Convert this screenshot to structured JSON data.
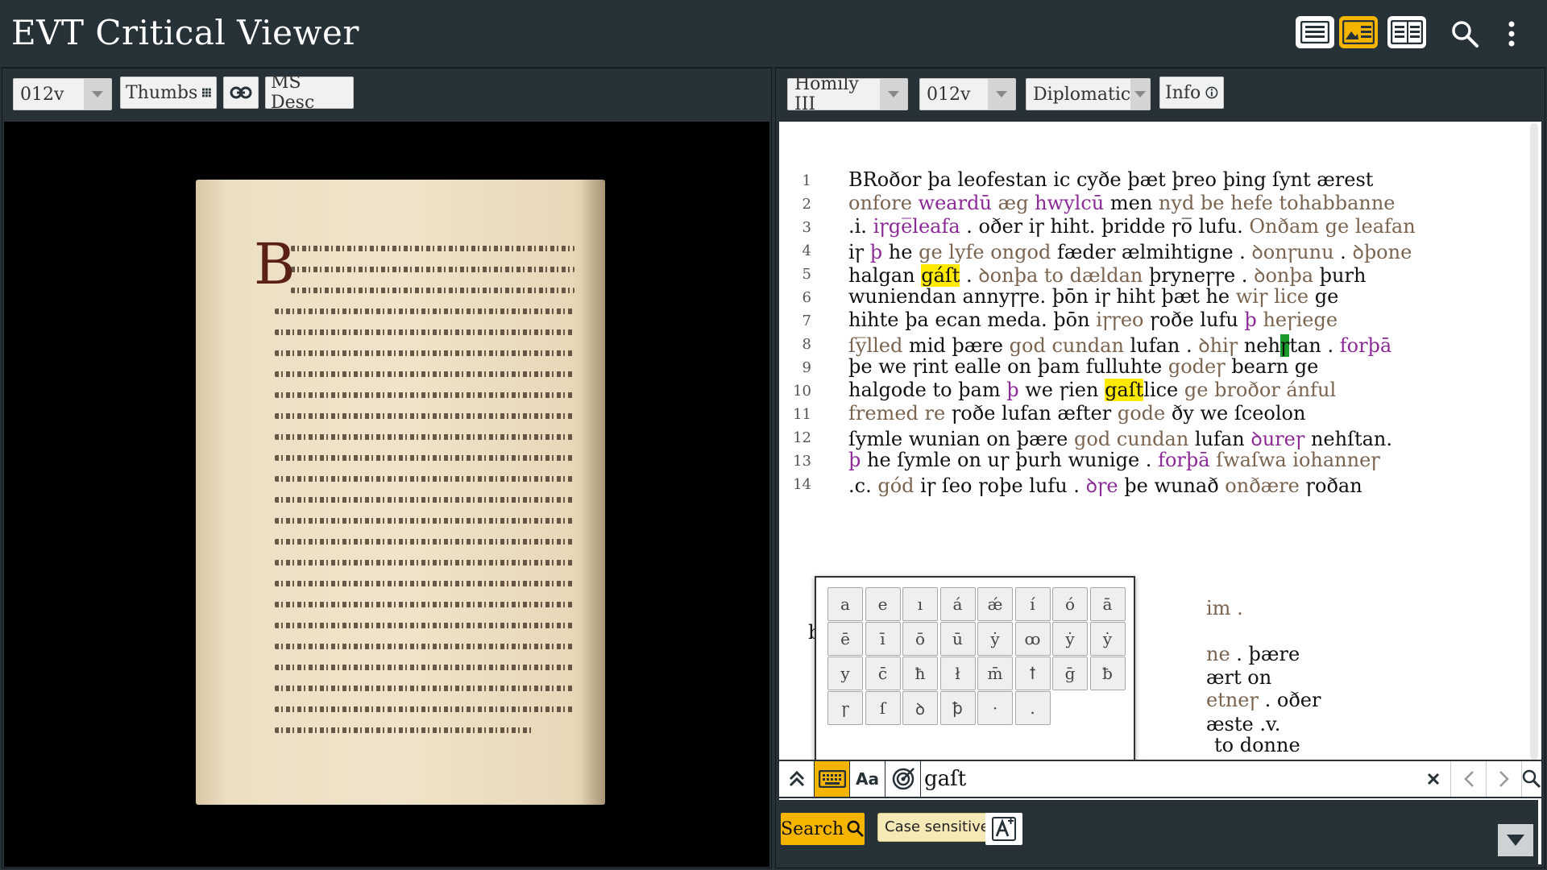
{
  "app": {
    "title": "EVT Critical Viewer"
  },
  "header": {
    "buttons": [
      "text-view-icon",
      "image-text-view-icon",
      "text-text-view-icon",
      "search-icon",
      "more-vert-icon"
    ]
  },
  "left_panel": {
    "page_select": "012v",
    "thumbs_label": "Thumbs",
    "ms_desc_label": "MS Desc"
  },
  "right_panel": {
    "document_select": "Homily III",
    "page_select": "012v",
    "edition_select": "Diplomatic",
    "info_label": "Info"
  },
  "text_lines": [
    {
      "n": "1",
      "segments": [
        {
          "t": "BRoðor þa leofestan ic cyðe þæt þreo þing ſynt ærest",
          "c": ""
        }
      ]
    },
    {
      "n": "2",
      "segments": [
        {
          "t": " onfore ",
          "c": "brown"
        },
        {
          "t": "weardū",
          "c": "purple"
        },
        {
          "t": " æg ",
          "c": "brown"
        },
        {
          "t": "hwylcū",
          "c": "purple"
        },
        {
          "t": " men ",
          "c": ""
        },
        {
          "t": "nyd be hefe tohabbanne",
          "c": "brown"
        }
      ]
    },
    {
      "n": "3",
      "segments": [
        {
          "t": ".i. ",
          "c": ""
        },
        {
          "t": "iꞅge̅leafa",
          "c": "purple"
        },
        {
          "t": " . oðer iꞅ hiht. þridde ꞅo̅ lufu. ",
          "c": ""
        },
        {
          "t": "Onðam ge leafan",
          "c": "brown"
        }
      ]
    },
    {
      "n": "4",
      "segments": [
        {
          "t": "iꞅ ",
          "c": ""
        },
        {
          "t": "þ",
          "c": "purple"
        },
        {
          "t": " he ",
          "c": ""
        },
        {
          "t": "ge lyfe ongod",
          "c": "brown"
        },
        {
          "t": " fæder ælmihtigne . ",
          "c": ""
        },
        {
          "t": "ꝺonꞅunu",
          "c": "brown"
        },
        {
          "t": " . ",
          "c": ""
        },
        {
          "t": "ꝺþone",
          "c": "brown"
        }
      ]
    },
    {
      "n": "5",
      "segments": [
        {
          "t": "halgan ",
          "c": ""
        },
        {
          "t": "gáſt",
          "c": "hl"
        },
        {
          "t": " . ",
          "c": ""
        },
        {
          "t": "ꝺonþa to dældan",
          "c": "brown"
        },
        {
          "t": " þryneꞅꞅe . ",
          "c": ""
        },
        {
          "t": "ꝺonþa",
          "c": "brown"
        },
        {
          "t": " þurh",
          "c": ""
        }
      ]
    },
    {
      "n": "6",
      "segments": [
        {
          "t": "wuniendan annyꞅꞅe. þōn iꞅ hiht þæt he ",
          "c": ""
        },
        {
          "t": "wiꞅ lice",
          "c": "brown"
        },
        {
          "t": " ge",
          "c": ""
        }
      ]
    },
    {
      "n": "7",
      "segments": [
        {
          "t": "hihte þa ecan meda. þōn ",
          "c": ""
        },
        {
          "t": "iꞅꞅeo",
          "c": "brown"
        },
        {
          "t": " ꞅoðe lufu ",
          "c": ""
        },
        {
          "t": "þ",
          "c": "purple"
        },
        {
          "t": " ",
          "c": ""
        },
        {
          "t": "heꞅiege",
          "c": "brown"
        }
      ]
    },
    {
      "n": "8",
      "segments": [
        {
          "t": "ſy̅lled",
          "c": "brown"
        },
        {
          "t": " mid þære ",
          "c": ""
        },
        {
          "t": "god cundan",
          "c": "brown"
        },
        {
          "t": " lufan . ",
          "c": ""
        },
        {
          "t": "ꝺhiꞅ",
          "c": "brown"
        },
        {
          "t": " neh",
          "c": ""
        },
        {
          "t": "ꞅ",
          "c": "green"
        },
        {
          "t": "tan . ",
          "c": ""
        },
        {
          "t": "forþā",
          "c": "purple"
        }
      ]
    },
    {
      "n": "9",
      "segments": [
        {
          "t": "þe we ꞅint ealle on þam fulluhte ",
          "c": ""
        },
        {
          "t": "godeꞅ",
          "c": "brown"
        },
        {
          "t": " bearn ge",
          "c": ""
        }
      ]
    },
    {
      "n": "10",
      "segments": [
        {
          "t": "halgode to þam ",
          "c": ""
        },
        {
          "t": "þ",
          "c": "purple"
        },
        {
          "t": " we ꞅien ",
          "c": ""
        },
        {
          "t": "gaſt",
          "c": "hl"
        },
        {
          "t": "lice ",
          "c": ""
        },
        {
          "t": "ge broðor ánful",
          "c": "brown"
        }
      ]
    },
    {
      "n": "11",
      "segments": [
        {
          "t": "fremed re",
          "c": "brown"
        },
        {
          "t": " ꞅoðe lufan æfter ",
          "c": ""
        },
        {
          "t": "gode",
          "c": "brown"
        },
        {
          "t": " ðy we ſceolon",
          "c": ""
        }
      ]
    },
    {
      "n": "12",
      "segments": [
        {
          "t": "ſymle wunian on þære ",
          "c": ""
        },
        {
          "t": "god cundan",
          "c": "brown"
        },
        {
          "t": " lufan ",
          "c": ""
        },
        {
          "t": "ꝺureꞅ",
          "c": "purple"
        },
        {
          "t": " nehſtan.",
          "c": ""
        }
      ]
    },
    {
      "n": "13",
      "segments": [
        {
          "t": " þ",
          "c": "purple"
        },
        {
          "t": " he ſymle on uꞅ þurh wunige . ",
          "c": ""
        },
        {
          "t": "forþā",
          "c": "purple"
        },
        {
          "t": " ",
          "c": ""
        },
        {
          "t": "ſwaſwa iohanneꞅ",
          "c": "brown"
        }
      ]
    },
    {
      "n": "14",
      "segments": [
        {
          "t": ".c. ",
          "c": ""
        },
        {
          "t": "gód",
          "c": "brown"
        },
        {
          "t": " iꞅ ſeo ꞅoþe lufu . ",
          "c": ""
        },
        {
          "t": "ꝺꞅe",
          "c": "purple"
        },
        {
          "t": " þe wunað ",
          "c": ""
        },
        {
          "t": "onðære",
          "c": "brown"
        },
        {
          "t": " ꞅoðan",
          "c": ""
        }
      ]
    }
  ],
  "hidden_fragments": {
    "l15": "im .",
    "l16_left": "b",
    "l17": "ne . þære",
    "l18": "ært on",
    "l19": "etneꞅ . oðer",
    "l20": "æste .v.",
    "l21": "to donne"
  },
  "keyboard": {
    "keys": [
      "a",
      "e",
      "ı",
      "á",
      "ǽ",
      "í",
      "ó",
      "ā",
      "ē",
      "ī",
      "ō",
      "ū",
      "ẏ",
      "ꝏ",
      "ẏ",
      "ẏ",
      "y",
      "c̄",
      "ħ",
      "ł",
      "m̄",
      "ꝉ",
      "ḡ",
      "ƀ",
      "ꞅ",
      "ſ",
      "ꝺ",
      "ꝥ",
      "·",
      "."
    ]
  },
  "search": {
    "query": "gaſt",
    "case_label": "Aa",
    "search_button_label": "Search",
    "tooltip": "Case sensitive"
  },
  "colors": {
    "header_bg": "#263238",
    "accent": "#f5b400",
    "purple_text": "#8b2a96",
    "brown_text": "#7a6450",
    "highlight": "#ffea00",
    "match": "#1a9a2a"
  }
}
